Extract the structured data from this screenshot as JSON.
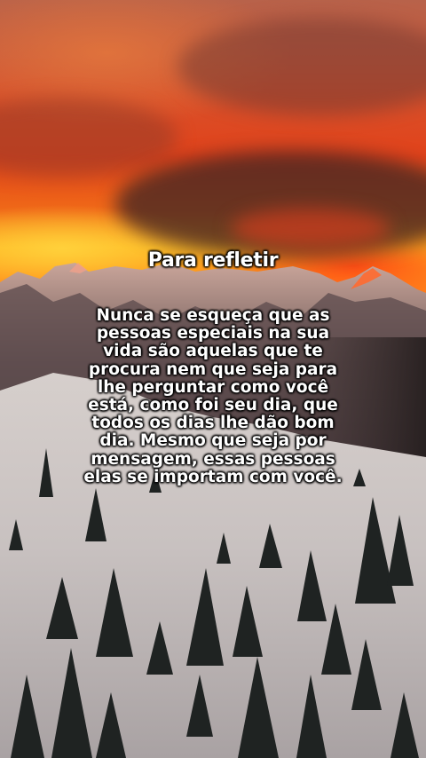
{
  "post": {
    "title": "Para refletir",
    "body": "Nunca se esqueça que as pessoas especiais na sua vida são aquelas que te procura nem que seja para lhe perguntar como você está, como foi seu dia, que todos os dias lhe dão bom dia. Mesmo que seja por mensagem, essas pessoas elas se importam com você."
  }
}
